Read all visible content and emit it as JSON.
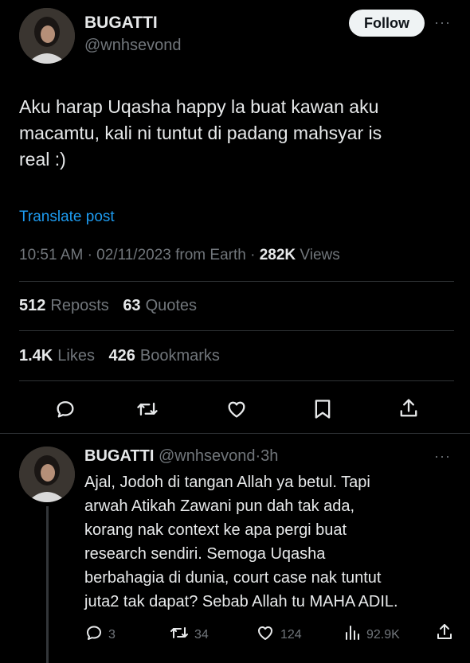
{
  "tweet": {
    "display_name": "BUGATTI",
    "handle": "@wnhsevond",
    "follow_label": "Follow",
    "more_label": "···",
    "text_lines": [
      "Aku harap Uqasha happy la buat kawan aku",
      "macamtu, kali ni tuntut di padang mahsyar is",
      "real :)"
    ],
    "translate_label": "Translate post",
    "time": "10:51 AM",
    "sep1": "·",
    "date": "02/11/2023 from Earth",
    "sep2": "·",
    "views_count": "282K",
    "views_label": "Views",
    "reposts_count": "512",
    "reposts_label": "Reposts",
    "quotes_count": "63",
    "quotes_label": "Quotes",
    "likes_count": "1.4K",
    "likes_label": "Likes",
    "bookmarks_count": "426",
    "bookmarks_label": "Bookmarks",
    "action_icons": [
      "reply-icon",
      "repost-icon",
      "like-icon",
      "bookmark-icon",
      "share-icon"
    ]
  },
  "reply": {
    "display_name": "BUGATTI",
    "handle": "@wnhsevond",
    "sep": "·",
    "time": "3h",
    "more_label": "···",
    "text_lines": [
      "Ajal, Jodoh di tangan Allah ya betul. Tapi",
      "arwah Atikah Zawani pun dah tak ada,",
      "korang nak context ke apa pergi buat",
      "research sendiri. Semoga Uqasha",
      "berbahagia di dunia, court case nak tuntut",
      "juta2 tak dapat? Sebab Allah tu MAHA ADIL."
    ],
    "reply_count": "3",
    "repost_count": "34",
    "like_count": "124",
    "view_count": "92.9K"
  },
  "colors": {
    "background": "#000000",
    "text": "#e7e9ea",
    "muted": "#71767b",
    "link": "#1d9bf0",
    "divider": "#2f3336"
  }
}
